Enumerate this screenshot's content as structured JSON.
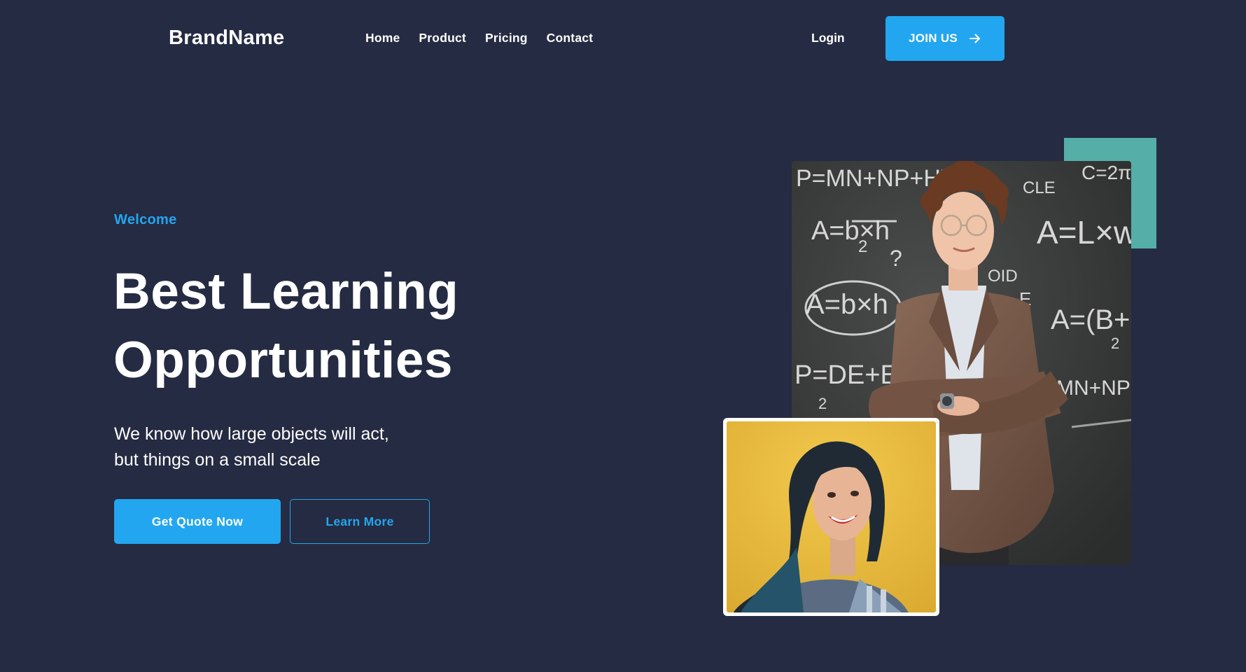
{
  "header": {
    "brand": "BrandName",
    "nav": [
      "Home",
      "Product",
      "Pricing",
      "Contact"
    ],
    "login_label": "Login",
    "join_label": "JOIN US"
  },
  "hero": {
    "eyebrow": "Welcome",
    "title_line1": "Best Learning",
    "title_line2": "Opportunities",
    "subtitle_line1": "We know how large objects will act,",
    "subtitle_line2": "but things on a small scale",
    "primary_cta": "Get Quote Now",
    "secondary_cta": "Learn More"
  },
  "chalkboard": {
    "formulas": [
      "P=MN+NP+HT",
      "C=2π",
      "CLE",
      "A=b×h",
      "2",
      "?",
      "A=L×w",
      "A=b×h",
      "OID",
      "E",
      "A=(B+b)",
      "2",
      "P=DE+E",
      "2",
      "MN+NP+F"
    ]
  },
  "colors": {
    "background": "#252b42",
    "accent": "#23a6f0",
    "teal": "#55aea7",
    "text": "#ffffff"
  },
  "icons": {
    "join_arrow": "arrow-right-icon"
  }
}
